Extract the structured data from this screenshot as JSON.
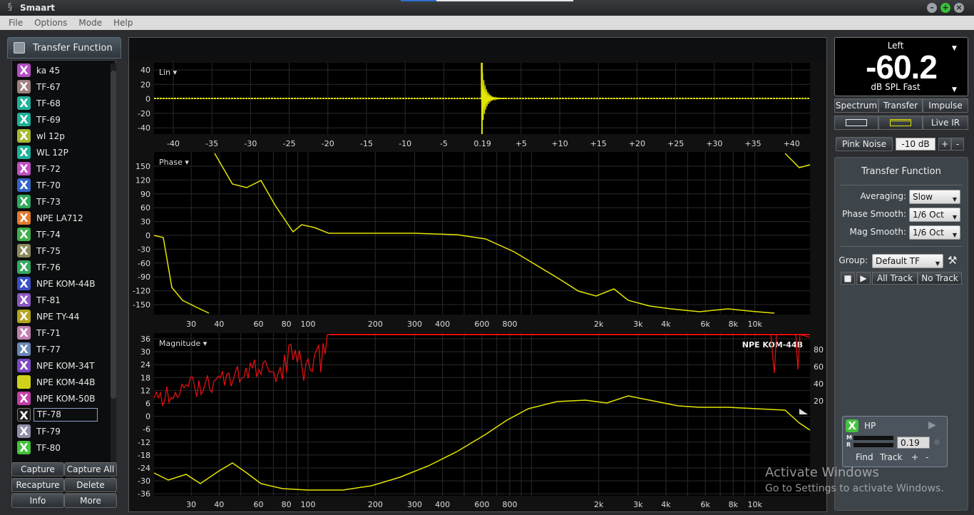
{
  "window": {
    "title": "Smaart",
    "app_icon": "smaart-logo-icon",
    "buttons": [
      "minimize-icon",
      "maximize-icon",
      "close-icon"
    ]
  },
  "menu": [
    "File",
    "Options",
    "Mode",
    "Help"
  ],
  "left": {
    "header": "Transfer Function",
    "traces": [
      {
        "label": "ka 45",
        "color": "#b44fc2"
      },
      {
        "label": "TF-67",
        "color": "#9e7f7f"
      },
      {
        "label": "TF-68",
        "color": "#1faf9a"
      },
      {
        "label": "TF-69",
        "color": "#1faf9a"
      },
      {
        "label": "wl 12p",
        "color": "#a6b832"
      },
      {
        "label": "WL 12P",
        "color": "#1faf9a"
      },
      {
        "label": "TF-72",
        "color": "#c14fc1"
      },
      {
        "label": "TF-70",
        "color": "#3562c7"
      },
      {
        "label": "TF-73",
        "color": "#2fa85c"
      },
      {
        "label": "NPE LA712",
        "color": "#e07b2e"
      },
      {
        "label": "TF-74",
        "color": "#3fae4a"
      },
      {
        "label": "TF-75",
        "color": "#8b8a5c"
      },
      {
        "label": "TF-76",
        "color": "#33a861"
      },
      {
        "label": "NPE KOM-44B",
        "color": "#3a4fc5"
      },
      {
        "label": "TF-81",
        "color": "#8c58c0"
      },
      {
        "label": "NPE TY-44",
        "color": "#b3a41c"
      },
      {
        "label": "TF-71",
        "color": "#c07fb0"
      },
      {
        "label": "TF-77",
        "color": "#6a86b5"
      },
      {
        "label": "NPE KOM-34T",
        "color": "#7c49c0"
      },
      {
        "label": "NPE KOM-44B",
        "color": "#cfd21b"
      },
      {
        "label": "NPE KOM-50B",
        "color": "#c13fa8"
      },
      {
        "label": "TF-78",
        "color": "#1a1a1a"
      },
      {
        "label": "TF-79",
        "color": "#8d8ea8"
      },
      {
        "label": "TF-80",
        "color": "#45c23d"
      }
    ],
    "buttons": [
      "Capture",
      "Capture All",
      "Recapture",
      "Delete",
      "Info",
      "More"
    ]
  },
  "graphs": {
    "impulse": {
      "label": "Lin ▾",
      "y_ticks": [
        "40",
        "20",
        "0",
        "-20",
        "-40"
      ],
      "x_ticks": [
        "-40",
        "-35",
        "-30",
        "-25",
        "-20",
        "-15",
        "-10",
        "-5",
        "0.19",
        "+5",
        "+10",
        "+15",
        "+20",
        "+25",
        "+30",
        "+35",
        "+40"
      ]
    },
    "phase": {
      "label": "Phase ▾",
      "y_ticks": [
        "150",
        "120",
        "90",
        "60",
        "30",
        "0",
        "-30",
        "-60",
        "-90",
        "-120",
        "-150"
      ]
    },
    "magnitude": {
      "label": "Magnitude ▾",
      "trace_name": "NPE KOM-44B",
      "y_ticks": [
        "36",
        "30",
        "24",
        "18",
        "12",
        "6",
        "0",
        "-6",
        "-12",
        "-18",
        "-24",
        "-30",
        "-36"
      ],
      "coh_ticks": [
        "80",
        "60",
        "40",
        "20"
      ]
    },
    "freq_ticks": [
      "30",
      "40",
      "60",
      "80",
      "100",
      "200",
      "300",
      "400",
      "600",
      "800",
      "2k",
      "3k",
      "4k",
      "6k",
      "8k",
      "10k"
    ]
  },
  "right": {
    "meter": {
      "channel": "Left",
      "value": "-60.2",
      "unit": "dB SPL Fast"
    },
    "tabs": [
      "Spectrum",
      "Transfer",
      "Impulse"
    ],
    "live_ir": "Live IR",
    "generator": {
      "label": "Pink Noise",
      "level": "-10 dB",
      "plus": "+",
      "minus": "-"
    },
    "settings": {
      "title": "Transfer Function",
      "averaging_label": "Averaging:",
      "averaging": "Slow",
      "phase_smooth_label": "Phase Smooth:",
      "phase_smooth": "1/6 Oct",
      "mag_smooth_label": "Mag Smooth:",
      "mag_smooth": "1/6 Oct",
      "group_label": "Group:",
      "group": "Default TF",
      "all_track": "All Track",
      "no_track": "No Track"
    },
    "hp": {
      "name": "HP",
      "m": "M",
      "r": "R",
      "delay": "0.19",
      "find": "Find",
      "track": "Track",
      "plus": "+",
      "minus": "-"
    }
  },
  "watermark": {
    "line1": "Activate Windows",
    "line2": "Go to Settings to activate Windows."
  },
  "colors": {
    "trace_yellow": "#e3e600",
    "coherence_red": "#e01010",
    "background": "#000000"
  }
}
